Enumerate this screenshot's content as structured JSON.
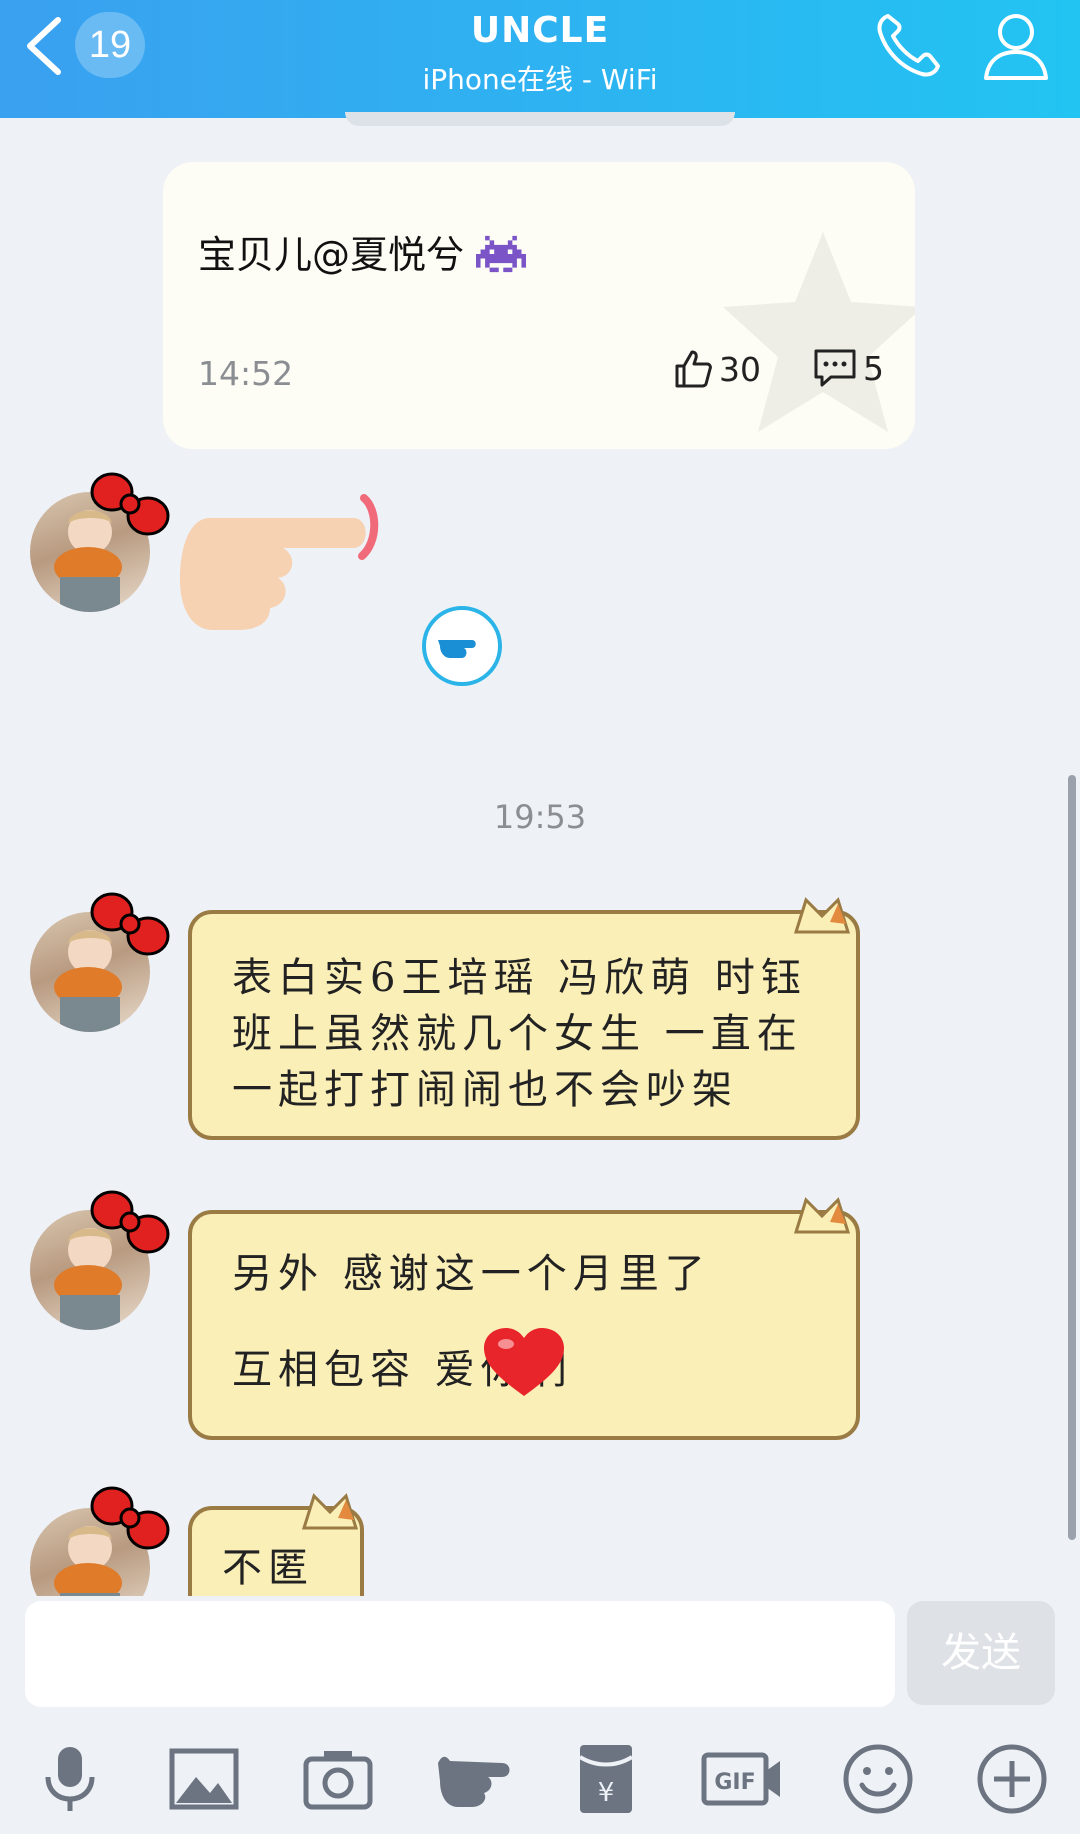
{
  "header": {
    "badge": "19",
    "title": "UNCLE",
    "subtitle": "iPhone在线 - WiFi"
  },
  "post": {
    "text": "宝贝儿@夏悦兮",
    "time": "14:52",
    "likes": "30",
    "comments": "5"
  },
  "time_divider": "19:53",
  "messages": [
    {
      "text": "表白实6王培瑶 冯欣萌 时钰 班上虽然就几个女生 一直在一起打打闹闹也不会吵架"
    },
    {
      "text": "另外 感谢这一个月里了互相包容 爱你们"
    },
    {
      "text": "不匿"
    }
  ],
  "composer": {
    "input_value": "",
    "send_label": "发送"
  },
  "toolbar": [
    "mic-icon",
    "image-icon",
    "camera-icon",
    "poke-icon",
    "red-packet-icon",
    "gif-icon",
    "emoji-icon",
    "plus-icon"
  ]
}
